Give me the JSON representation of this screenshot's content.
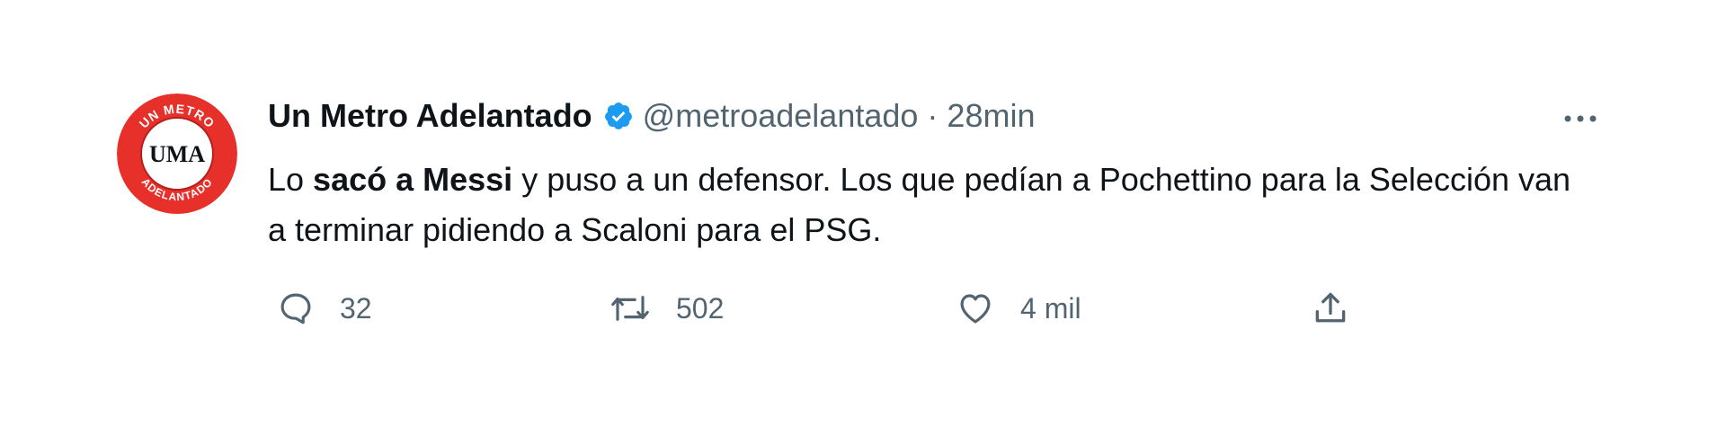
{
  "tweet": {
    "author_name": "Un Metro Adelantado",
    "handle": "@metroadelantado",
    "separator": "·",
    "time": "28min",
    "text_parts": {
      "p1": "Lo ",
      "p2": "sacó a Messi",
      "p3": " y puso a un defensor. Los que pedían a Pochettino para la Selección van a terminar pidiendo a Scaloni para el PSG."
    },
    "avatar": {
      "initials": "UMA",
      "top_text": "UN METRO",
      "bottom_text": "ADELANTADO",
      "color": "#e8302b"
    },
    "verified_color": "#1d9bf0"
  },
  "actions": {
    "reply_icon": "reply-icon",
    "replies": "32",
    "retweet_icon": "retweet-icon",
    "retweets": "502",
    "like_icon": "heart-icon",
    "likes": "4 mil",
    "share_icon": "share-icon"
  }
}
